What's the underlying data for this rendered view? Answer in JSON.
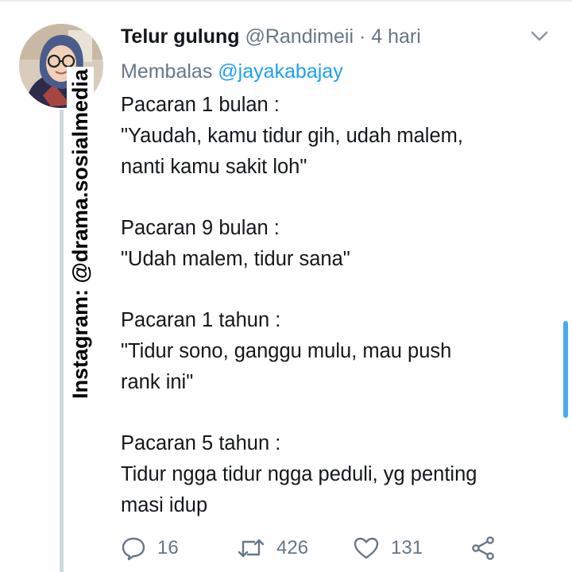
{
  "tweet": {
    "display_name": "Telur gulung",
    "handle": "@Randimeii",
    "separator": "·",
    "timestamp": "4 hari",
    "reply_prefix": "Membalas",
    "reply_to": "@jayakabajay",
    "paragraphs": [
      "Pacaran 1 bulan :\n\"Yaudah, kamu tidur gih, udah malem,\nnanti kamu sakit loh\"",
      "Pacaran 9 bulan :\n\"Udah malem, tidur sana\"",
      "Pacaran 1 tahun :\n\"Tidur sono, ganggu mulu, mau push\nrank ini\"",
      "Pacaran 5 tahun :\nTidur ngga tidur ngga peduli, yg penting\nmasi idup"
    ]
  },
  "actions": {
    "reply_count": "16",
    "retweet_count": "426",
    "like_count": "131"
  },
  "watermark": {
    "text": "Instagram: @drama.sosialmedia"
  },
  "colors": {
    "text": "#14171a",
    "secondary": "#657786",
    "accent": "#1da1f2",
    "thread_line": "#cfd9de"
  },
  "icons": [
    "chevron-down-icon",
    "reply-icon",
    "retweet-icon",
    "like-icon",
    "share-icon"
  ]
}
